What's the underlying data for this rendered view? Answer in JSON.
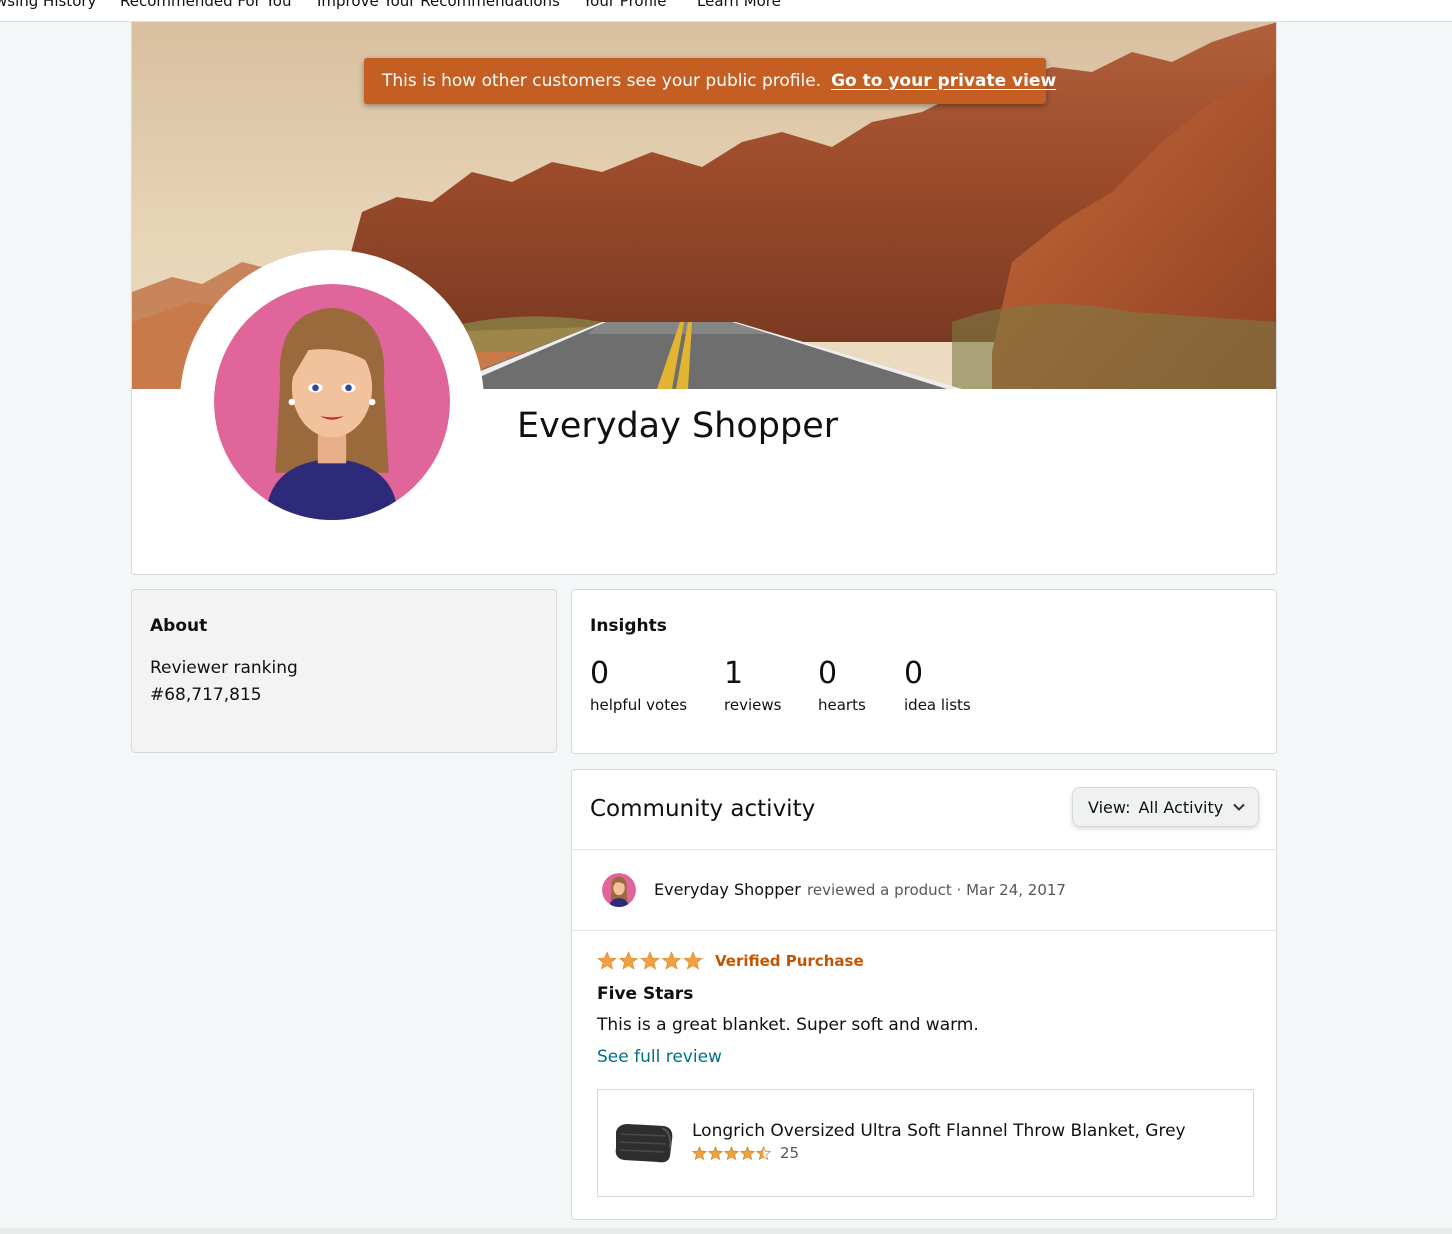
{
  "nav": {
    "items": [
      "wsing History",
      "Recommended For You",
      "Improve Your Recommendations",
      "Your Profile",
      "Learn More"
    ]
  },
  "profile": {
    "notice_text": "This is how other customers see your public profile.",
    "notice_link": "Go to your private view",
    "name": "Everyday Shopper",
    "cover_icon": "desert-road-image",
    "avatar_icon": "woman-avatar"
  },
  "about": {
    "heading": "About",
    "ranking_label": "Reviewer ranking",
    "ranking_value": "#68,717,815"
  },
  "insights": {
    "heading": "Insights",
    "stats": [
      {
        "value": "0",
        "label": "helpful votes"
      },
      {
        "value": "1",
        "label": "reviews"
      },
      {
        "value": "0",
        "label": "hearts"
      },
      {
        "value": "0",
        "label": "idea lists"
      }
    ]
  },
  "activity": {
    "title": "Community activity",
    "view_label": "View:",
    "view_selected": "All Activity",
    "items": [
      {
        "author": "Everyday Shopper",
        "meta": "reviewed a product · Mar 24, 2017",
        "rating": 5,
        "verified": "Verified Purchase",
        "review_title": "Five Stars",
        "review_body": "This is a great blanket. Super soft and warm.",
        "see_full": "See full review",
        "product": {
          "title": "Longrich Oversized Ultra Soft Flannel Throw Blanket, Grey",
          "rating": 4.5,
          "rating_count": "25",
          "thumb_icon": "blanket-thumbnail"
        }
      }
    ]
  },
  "colors": {
    "accent_orange": "#c45e22",
    "star": "#f0a043",
    "link_teal": "#007185",
    "verified": "#c45500"
  }
}
